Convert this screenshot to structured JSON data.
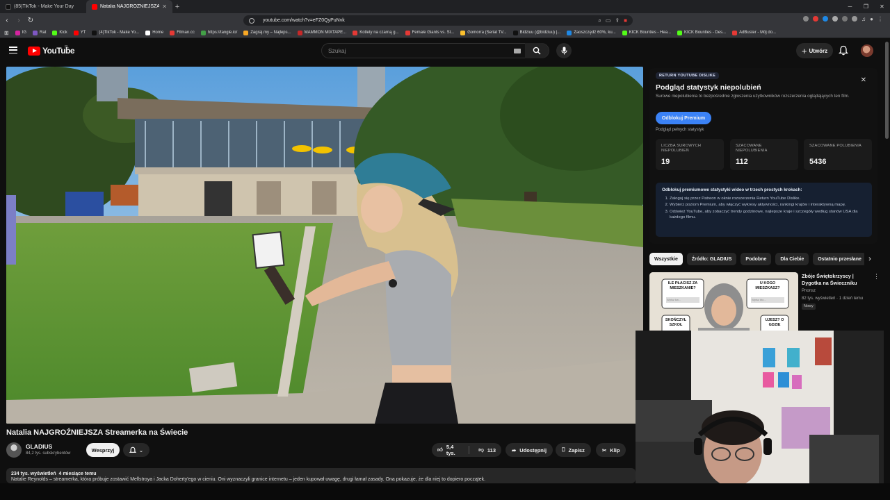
{
  "browser": {
    "tabs": [
      {
        "title": "(85)TikTok - Make Your Day",
        "active": false,
        "favicon_color": "#111111"
      },
      {
        "title": "Natalia NAJGROŹNIEJSZA Streamerka",
        "active": true,
        "favicon_color": "#ff0000"
      }
    ],
    "new_tab": "+",
    "url": "youtube.com/watch?v=eFZ0QyPuNvk",
    "bookmarks": [
      {
        "label": "IG",
        "color": "#d6249f"
      },
      {
        "label": "Rat",
        "color": "#7e57c2"
      },
      {
        "label": "Kick",
        "color": "#53fc18"
      },
      {
        "label": "YT",
        "color": "#ff0000"
      },
      {
        "label": "(4)TikTok - Make Yo...",
        "color": "#111111"
      },
      {
        "label": "Home",
        "color": "#ffffff"
      },
      {
        "label": "Filman.cc",
        "color": "#e53935"
      },
      {
        "label": "https://tangle.io/",
        "color": "#43a047"
      },
      {
        "label": "Zagraj.my – Najleps...",
        "color": "#f9a825"
      },
      {
        "label": "MAMMON MIXTAPE...",
        "color": "#c62828"
      },
      {
        "label": "Kotlety na czarną g...",
        "color": "#e53935"
      },
      {
        "label": "Female Giants vs. St...",
        "color": "#e53935"
      },
      {
        "label": "Gomorra (Serial TV...",
        "color": "#fbc02d"
      },
      {
        "label": "Bidziuu (@bidziuu) |...",
        "color": "#111111"
      },
      {
        "label": "Zaoszczędź 60%, ku...",
        "color": "#1e88e5"
      },
      {
        "label": "KICK Bounties - Hea...",
        "color": "#53fc18"
      },
      {
        "label": "KICK Bounties - Des...",
        "color": "#53fc18"
      },
      {
        "label": "AdBuster - Mój do...",
        "color": "#e53935"
      }
    ]
  },
  "masthead": {
    "logo_text": "YouTube",
    "country_code": "PL",
    "search_placeholder": "Szukaj",
    "create_label": "Utwórz",
    "icons": [
      "menu-icon",
      "search-icon",
      "mic-icon",
      "bell-icon"
    ]
  },
  "video": {
    "title": "Natalia NAJGROŹNIEJSZA Streamerka na Świecie",
    "channel": "GLADIUS",
    "subscribers": "84,2 tys. subskrybentów",
    "support_label": "Wesprzyj",
    "likes": "5,4 tys.",
    "dislikes": "113",
    "share_label": "Udostępnij",
    "save_label": "Zapisz",
    "clip_label": "Klip",
    "views": "234 tys. wyświetleń",
    "age": "4 miesiące temu",
    "description": "Natalie Reynolds – streamerka, która próbuje zostawić Mellstroya i Jacka Doherty'ego w cieniu. Oni wyznaczyli granice internetu – jeden kupował uwagę, drugi łamał zasady. Ona pokazuje, że dla niej to dopiero początek."
  },
  "ryd": {
    "tag": "RETURN YOUTUBE DISLIKE",
    "title": "Podgląd statystyk niepolubień",
    "subtitle": "Surowe niepolubienia to bezpośrednie zgłoszenia użytkowników rozszerzenia oglądających ten film.",
    "button": "Odblokuj Premium",
    "note": "Podgląd pełnych statystyk",
    "stats": [
      {
        "label": "LICZBA SUROWYCH NIEPOLUBIEŃ",
        "value": "19"
      },
      {
        "label": "SZACOWANE NIEPOLUBIENIA",
        "value": "112"
      },
      {
        "label": "SZACOWANE POLUBIENIA",
        "value": "5436"
      }
    ],
    "box_title": "Odblokuj premiumowe statystyki wideo w trzech prostych krokach:",
    "steps": [
      "Zaloguj się przez Patreon w oknie rozszerzenia Return YouTube Dislike.",
      "Wybierz poziom Premium, aby włączyć wykresy aktywności, rankingi krajów i interaktywną mapę.",
      "Odśwież YouTube, aby zobaczyć trendy godzinowe, najlepsze kraje i szczegóły według stanów USA dla każdego filmu."
    ]
  },
  "chips": [
    "Wszystkie",
    "Źródło: GLADIUS",
    "Podobne",
    "Dla Ciebie",
    "Ostatnio przesłane"
  ],
  "recommendation": {
    "title": "Zbóje Świętokrzyscy | Dygotka na Świeczniku",
    "channel": "Pnonsz",
    "views": "82 tys. wyświetleń",
    "age": "1 dzień temu",
    "badge": "Nowy",
    "thumb_bubbles": [
      "ILE PŁACISZ ZA MIESZKANIE?",
      "U KOGO MIESZKASZ?",
      "SKOŃCZYŁ SZKOŁ",
      "UJESZ? O GDZIE"
    ],
    "thumb_inputs": [
      "Wpisz kw...",
      "Wpisz kto..."
    ]
  },
  "colors": {
    "accent": "#ff0000",
    "ryd_button": "#3b82f6",
    "background": "#0f0f0f"
  }
}
